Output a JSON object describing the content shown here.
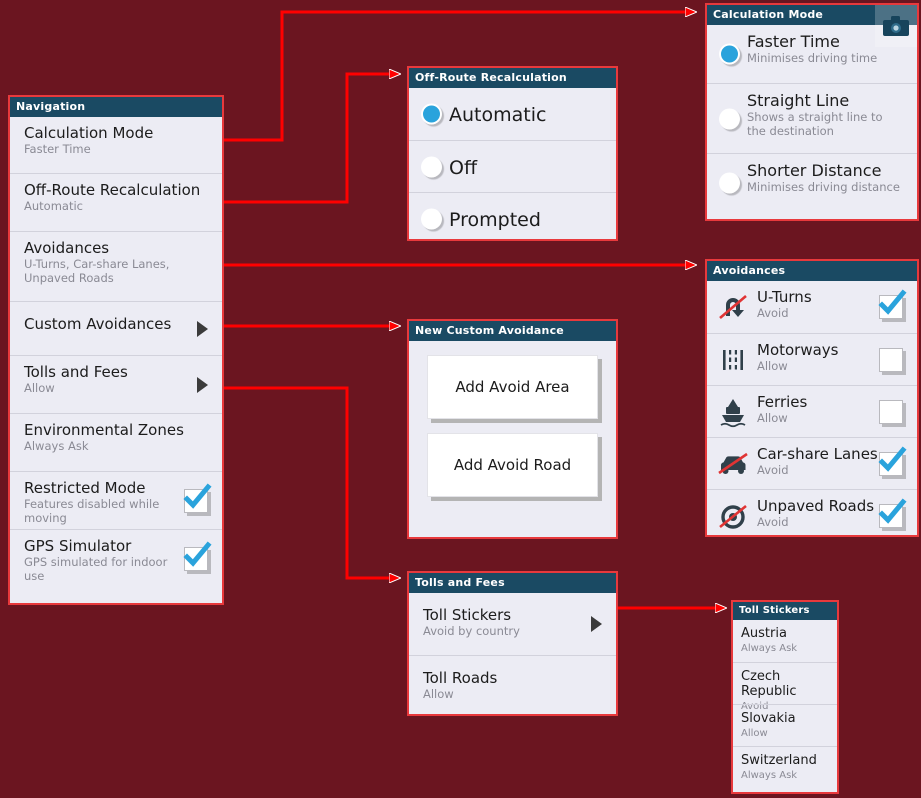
{
  "theme": {
    "background": "#6B1520",
    "panel_bg": "#ECECF4",
    "panel_border": "#E8393C",
    "header_bg": "#1A4A63",
    "accent_blue": "#2AA3DC",
    "connector": "#FF0000",
    "sub_text": "#8A8A94"
  },
  "navigation": {
    "header": "Navigation",
    "items": [
      {
        "title": "Calculation Mode",
        "sub": "Faster Time",
        "control": "none"
      },
      {
        "title": "Off-Route Recalculation",
        "sub": "Automatic",
        "control": "none"
      },
      {
        "title": "Avoidances",
        "sub": "U-Turns, Car-share Lanes, Unpaved Roads",
        "control": "none"
      },
      {
        "title": "Custom Avoidances",
        "sub": "",
        "control": "chevron"
      },
      {
        "title": "Tolls and Fees",
        "sub": "Allow",
        "control": "chevron"
      },
      {
        "title": "Environmental Zones",
        "sub": "Always Ask",
        "control": "none"
      },
      {
        "title": "Restricted Mode",
        "sub": "Features disabled while moving",
        "control": "checkbox",
        "checked": true
      },
      {
        "title": "GPS Simulator",
        "sub": "GPS simulated for indoor use",
        "control": "checkbox",
        "checked": true
      }
    ]
  },
  "off_route": {
    "header": "Off-Route Recalculation",
    "options": [
      {
        "label": "Automatic",
        "selected": true
      },
      {
        "label": "Off",
        "selected": false
      },
      {
        "label": "Prompted",
        "selected": false
      }
    ]
  },
  "calculation_mode": {
    "header": "Calculation Mode",
    "camera_icon": "camera-icon",
    "options": [
      {
        "label": "Faster Time",
        "sub": "Minimises driving time",
        "selected": true
      },
      {
        "label": "Straight Line",
        "sub": "Shows a straight line to the destination",
        "selected": false
      },
      {
        "label": "Shorter Distance",
        "sub": "Minimises driving distance",
        "selected": false
      }
    ]
  },
  "avoidances": {
    "header": "Avoidances",
    "items": [
      {
        "title": "U-Turns",
        "sub": "Avoid",
        "icon": "u-turn-icon",
        "checked": true
      },
      {
        "title": "Motorways",
        "sub": "Allow",
        "icon": "motorway-icon",
        "checked": false
      },
      {
        "title": "Ferries",
        "sub": "Allow",
        "icon": "ferry-icon",
        "checked": false
      },
      {
        "title": "Car-share Lanes",
        "sub": "Avoid",
        "icon": "car-share-icon",
        "checked": true
      },
      {
        "title": "Unpaved Roads",
        "sub": "Avoid",
        "icon": "unpaved-road-icon",
        "checked": true
      }
    ]
  },
  "custom_avoidance": {
    "header": "New Custom Avoidance",
    "buttons": [
      {
        "label": "Add Avoid Area"
      },
      {
        "label": "Add Avoid Road"
      }
    ]
  },
  "tolls_and_fees": {
    "header": "Tolls and Fees",
    "items": [
      {
        "title": "Toll Stickers",
        "sub": "Avoid by country",
        "control": "chevron"
      },
      {
        "title": "Toll Roads",
        "sub": "Allow",
        "control": "none"
      }
    ]
  },
  "toll_stickers": {
    "header": "Toll Stickers",
    "items": [
      {
        "title": "Austria",
        "sub": "Always Ask"
      },
      {
        "title": "Czech Republic",
        "sub": "Avoid"
      },
      {
        "title": "Slovakia",
        "sub": "Allow"
      },
      {
        "title": "Switzerland",
        "sub": "Always Ask"
      }
    ]
  }
}
